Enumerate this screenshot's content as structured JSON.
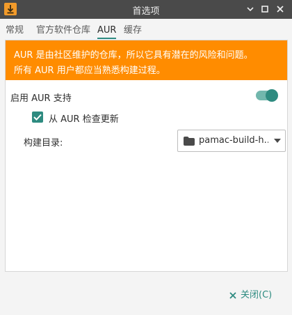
{
  "window": {
    "title": "首选项",
    "icon": "download-arrow-icon",
    "controls": [
      "minimize-icon",
      "maximize-icon",
      "close-icon"
    ]
  },
  "tabs": [
    {
      "label": "常规",
      "active": false
    },
    {
      "label": "官方软件仓库",
      "active": false
    },
    {
      "label": "AUR",
      "active": true
    },
    {
      "label": "缓存",
      "active": false
    }
  ],
  "banner": {
    "line1": "AUR 是由社区维护的仓库，所以它具有潜在的风险和问题。",
    "line2": "所有 AUR 用户都应当熟悉构建过程。",
    "color": "#ff8c00"
  },
  "aur_support": {
    "label": "启用 AUR 支持",
    "enabled": true
  },
  "check_updates": {
    "label": "从 AUR 检查更新",
    "checked": true
  },
  "build_dir": {
    "label": "构建目录:",
    "value": "pamac-build-h..."
  },
  "footer": {
    "close_label": "关闭(C)"
  },
  "colors": {
    "accent": "#2e8b80",
    "warning": "#ff8c00",
    "titlebar": "#4a4a4a"
  }
}
